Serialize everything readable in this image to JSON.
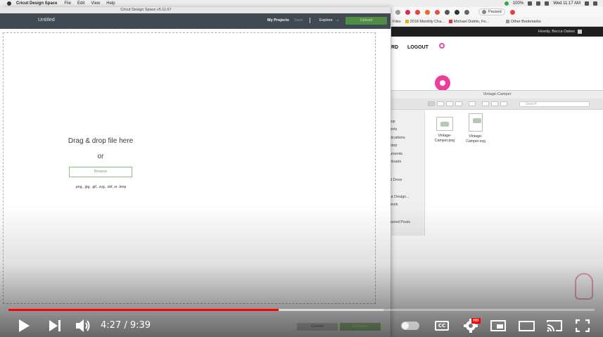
{
  "menubar": {
    "app_name": "Cricut Design Space",
    "menus": [
      "File",
      "Edit",
      "View",
      "Help"
    ],
    "battery": "100%",
    "clock": "Wed 11:17 AM"
  },
  "browser": {
    "profile_status": "Paused",
    "bookmarks": [
      "Files",
      "2018 Monthly Cha...",
      "Michael Dublin, Fo...",
      "Other Bookmarks"
    ],
    "admin_greeting": "Howdy, Becca Oakes",
    "nav_partial": "RD",
    "nav_logout": "LOGOUT"
  },
  "finder": {
    "window_title": "Vintage-Camper",
    "search_placeholder": "Search",
    "sidebar_items": [
      "top",
      "ents",
      "oications",
      "ktop",
      "uments",
      "nloads",
      "d Drive",
      "ut Design...",
      "work",
      "sored Posts"
    ],
    "files": [
      {
        "name_line1": "Vintage-",
        "name_line2": "Camper.png"
      },
      {
        "name_line1": "Vintage-",
        "name_line2": "Camper.svg"
      }
    ]
  },
  "cricut": {
    "window_title": "Cricut Design Space  v5.11.67",
    "doc_title": "Untitled",
    "my_projects": "My Projects",
    "save": "Save",
    "explore": "Explore",
    "explore_chevron": "⌵",
    "header_button": "Upload",
    "drag_text": "Drag & drop file here",
    "or_text": "or",
    "browse_label": "Browse",
    "extensions": ".png, .jpg, .gif, .svg, .dxf, or .bmp",
    "footer_cancel": "Cancel",
    "footer_continue": "Continue"
  },
  "video": {
    "current_time": "4:27",
    "separator": " / ",
    "duration": "9:39",
    "played_fraction": 0.461,
    "loaded_fraction": 0.64,
    "cc_label": "CC",
    "hd_badge": "HD"
  }
}
